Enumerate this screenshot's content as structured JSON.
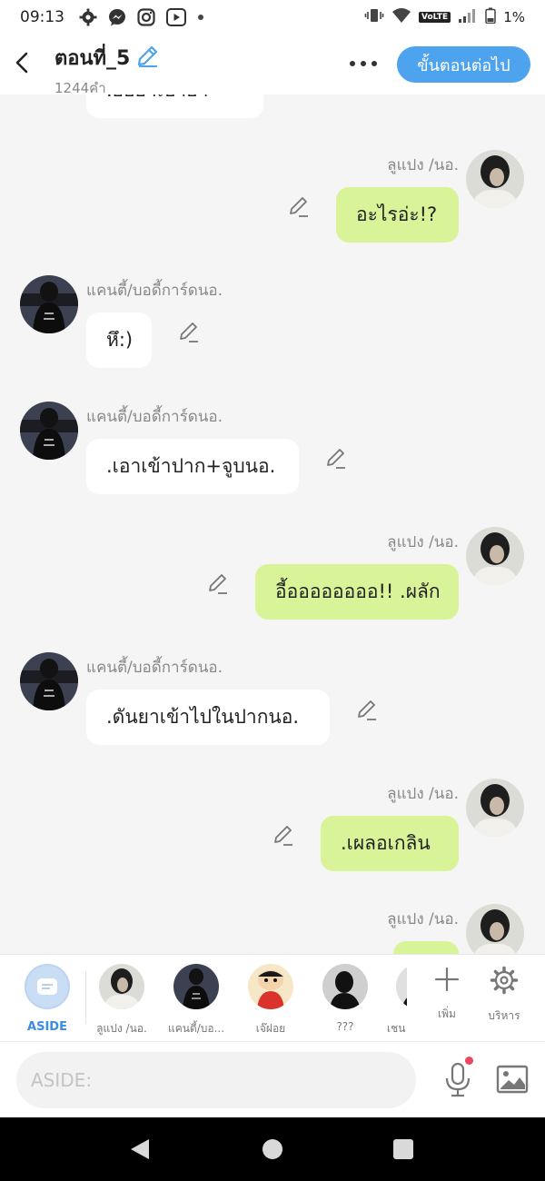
{
  "status_bar": {
    "time": "09:13",
    "battery": "1%",
    "network": "VoLTE"
  },
  "header": {
    "title": "ตอนที่_5",
    "word_count": "1244คำ",
    "next_button": "ขั้นตอนต่อไป"
  },
  "messages": [
    {
      "side": "left",
      "name": "",
      "text": ".ยอยาเบาอา"
    },
    {
      "side": "right",
      "name": "ลูแปง /นอ.",
      "text": "อะไรอ่ะ!?"
    },
    {
      "side": "left",
      "name": "แคนตี้/บอดี้การ์ดนอ.",
      "text": "หึ:)"
    },
    {
      "side": "left",
      "name": "แคนตี้/บอดี้การ์ดนอ.",
      "text": ".เอาเข้าปาก+จูบนอ."
    },
    {
      "side": "right",
      "name": "ลูแปง /นอ.",
      "text": "อี้ออออออออ!! .ผลัก"
    },
    {
      "side": "left",
      "name": "แคนตี้/บอดี้การ์ดนอ.",
      "text": ".ดันยาเข้าไปในปากนอ."
    },
    {
      "side": "right",
      "name": "ลูแปง /นอ.",
      "text": ".เผลอเกลิน"
    },
    {
      "side": "right",
      "name": "ลูแปง /นอ.",
      "text": ""
    }
  ],
  "characters": {
    "aside": "ASIDE",
    "items": [
      {
        "label": "ลูแปง /นอ."
      },
      {
        "label": "แคนตี้/บอ..."
      },
      {
        "label": "เจ๊ฝอย"
      },
      {
        "label": "???"
      },
      {
        "label": "เชน"
      }
    ],
    "add_label": "เพิ่ม",
    "manage_label": "บริหาร"
  },
  "input": {
    "placeholder": "ASIDE:"
  },
  "colors": {
    "accent": "#4da3ee",
    "bubble_right": "#d9f399",
    "bubble_left": "#ffffff",
    "background": "#f5f5f5"
  },
  "icons": [
    "settings-icon",
    "messenger-icon",
    "instagram-icon",
    "youtube-icon",
    "vibrate-icon",
    "wifi-icon",
    "signal-icon",
    "battery-icon",
    "back-icon",
    "pencil-icon",
    "more-icon",
    "plus-icon",
    "gear-icon",
    "mic-icon",
    "image-icon"
  ]
}
